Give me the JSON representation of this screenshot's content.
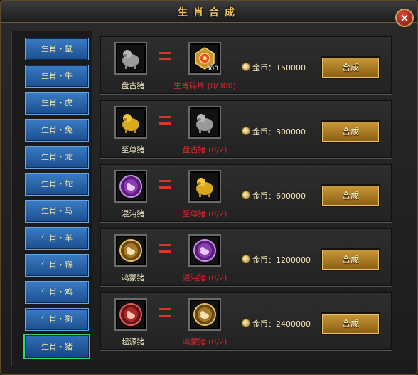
{
  "window": {
    "title": "生肖合成",
    "close_glyph": "×"
  },
  "sidebar": {
    "items": [
      {
        "label": "生肖・鼠",
        "active": false
      },
      {
        "label": "生肖・牛",
        "active": false
      },
      {
        "label": "生肖・虎",
        "active": false
      },
      {
        "label": "生肖・兔",
        "active": false
      },
      {
        "label": "生肖・龙",
        "active": false
      },
      {
        "label": "生肖・蛇",
        "active": false
      },
      {
        "label": "生肖・马",
        "active": false
      },
      {
        "label": "生肖・羊",
        "active": false
      },
      {
        "label": "生肖・猴",
        "active": false
      },
      {
        "label": "生肖・鸡",
        "active": false
      },
      {
        "label": "生肖・狗",
        "active": false
      },
      {
        "label": "生肖・猪",
        "active": true
      }
    ]
  },
  "recipes": [
    {
      "result_name": "盘古猪",
      "result_icon": "grey-pig-icon",
      "material_name": "生肖碎片 (0/300)",
      "material_icon": "zodiac-fragment-icon",
      "material_count": "300",
      "cost": "金币：150000",
      "button_label": "合成"
    },
    {
      "result_name": "至尊猪",
      "result_icon": "gold-pig-icon",
      "material_name": "盘古猪 (0/2)",
      "material_icon": "grey-pig-icon",
      "cost": "金币：300000",
      "button_label": "合成"
    },
    {
      "result_name": "混沌猪",
      "result_icon": "purple-pig-orb-icon",
      "material_name": "至尊猪 (0/2)",
      "material_icon": "gold-pig-icon",
      "cost": "金币：600000",
      "button_label": "合成"
    },
    {
      "result_name": "鸿蒙猪",
      "result_icon": "gold-pig-orb-icon",
      "material_name": "混沌猪 (0/2)",
      "material_icon": "purple-pig-orb-icon",
      "cost": "金币：1200000",
      "button_label": "合成"
    },
    {
      "result_name": "起源猪",
      "result_icon": "red-pig-orb-icon",
      "material_name": "鸿蒙猪 (0/2)",
      "material_icon": "gold-pig-orb-icon",
      "cost": "金币：2400000",
      "button_label": "合成"
    }
  ],
  "colors": {
    "title": "#f0c25a",
    "material_text": "#e0262a",
    "active_border": "#3bd46a"
  }
}
